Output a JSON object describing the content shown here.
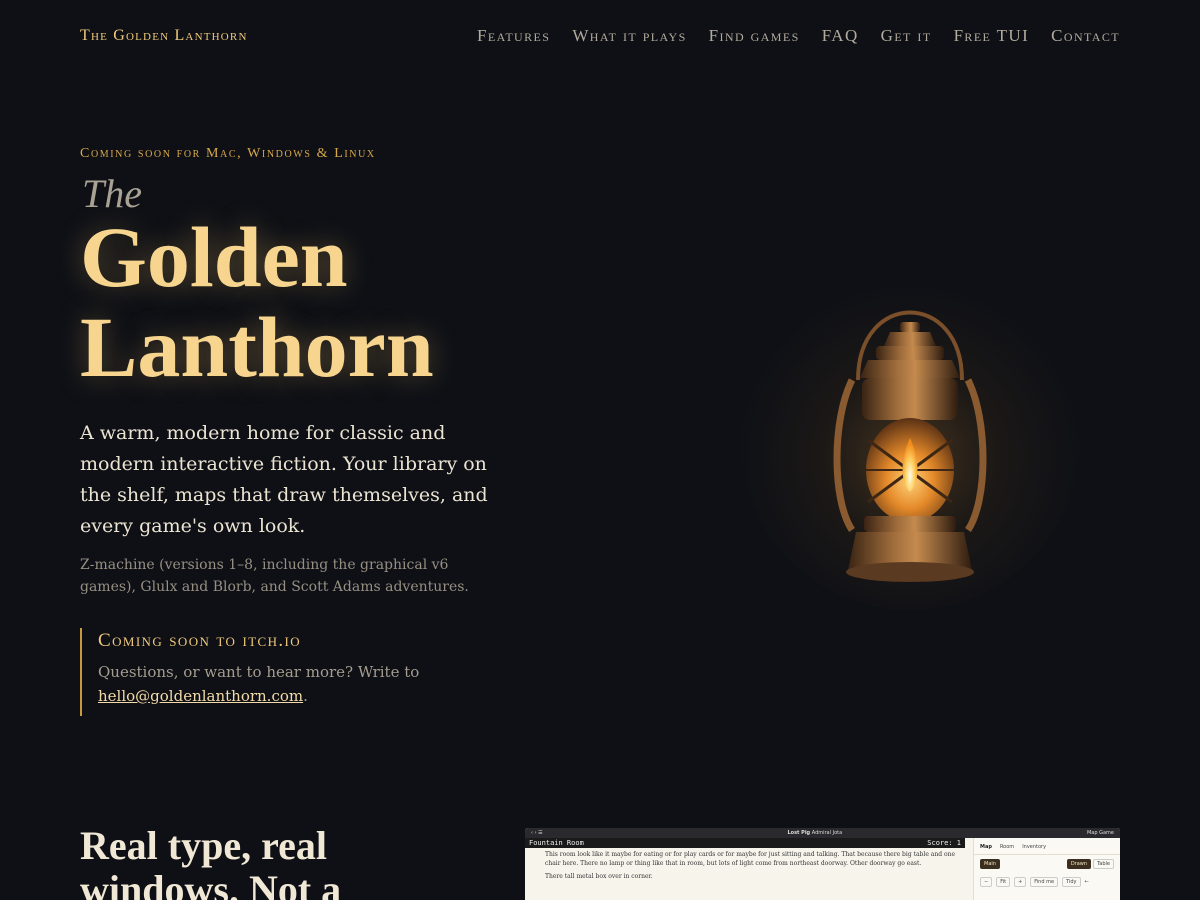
{
  "nav": {
    "brand": "The Golden Lanthorn",
    "links": [
      "Features",
      "What it plays",
      "Find games",
      "FAQ",
      "Get it",
      "Free TUI",
      "Contact"
    ]
  },
  "hero": {
    "eyebrow": "Coming soon for Mac, Windows & Linux",
    "title_prefix": "The",
    "title_line1": "Golden",
    "title_line2": "Lanthorn",
    "lede": "A warm, modern home for classic and modern interactive fiction. Your library on the shelf, maps that draw themselves, and every game's own look.",
    "formats": "Z-machine (versions 1–8, including the graphical v6 games), Glulx and Blorb, and Scott Adams adventures.",
    "callout": {
      "title": "Coming soon to itch.io",
      "body_prefix": "Questions, or want to hear more? Write to",
      "email": "hello@goldenlanthorn.com",
      "body_suffix": "."
    }
  },
  "section2": {
    "title": "Real type, real windows. Not a"
  },
  "app_preview": {
    "window_title": "Lost Pig",
    "window_subtitle": "Admiral Jota",
    "status_location": "Fountain Room",
    "status_score": "Score: 1",
    "paragraph1": "This room look like it maybe for eating or for play cards or for maybe for just sitting and talking. That because there big table and one chair here. There no lamp or thing like that in room, but lots of light come from northeast doorway. Other doorway go east.",
    "paragraph2": "There tall metal box over in corner.",
    "toolbar_map": "Map",
    "toolbar_game": "Game",
    "side_tabs": [
      "Map",
      "Room",
      "Inventory"
    ],
    "level": "Main",
    "view_drawn": "Drawn",
    "view_table": "Table",
    "zoom_out": "−",
    "zoom_fit": "Fit",
    "zoom_in": "+",
    "find_me": "Find me",
    "tidy": "Tidy",
    "back": "←"
  },
  "colors": {
    "background": "#0e1016",
    "gold": "#f7d58e",
    "accent": "#c99a3b"
  }
}
